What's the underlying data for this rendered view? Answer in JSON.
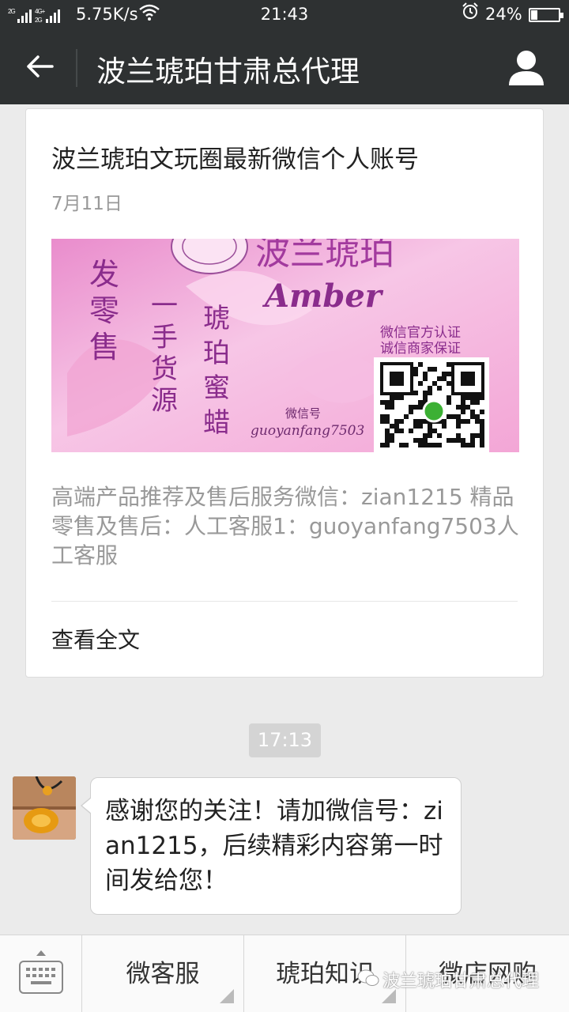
{
  "status_bar": {
    "signal": "2G 4G⁺ 2G",
    "net_speed": "5.75K/s",
    "time": "21:43",
    "battery_pct": "24%",
    "battery_level": 0.24
  },
  "nav": {
    "title": "波兰琥珀甘肃总代理"
  },
  "article": {
    "title": "波兰琥珀文玩圈最新微信个人账号",
    "date": "7月11日",
    "banner": {
      "top_text": "波兰琥珀",
      "word": "Amber",
      "left_col": "批发零售",
      "mid_col": "一手货源",
      "right_col": "琥珀蜜蜡",
      "cert1": "微信官方认证",
      "cert2": "诚信商家保证",
      "wechat_label": "微信号",
      "wechat_id": "guoyanfang7503"
    },
    "description": "高端产品推荐及售后服务微信：zian1215 精品零售及售后：人工客服1：guoyanfang7503人工客服",
    "read_more": "查看全文"
  },
  "chat": {
    "timestamp": "17:13",
    "message": "感谢您的关注！请加微信号：zian1215，后续精彩内容第一时间发给您！"
  },
  "menu": {
    "items": [
      {
        "label": "微客服"
      },
      {
        "label": "琥珀知识"
      },
      {
        "label": "微店网购"
      }
    ]
  },
  "watermark": "波兰琥珀甘肃总代理",
  "icons": {
    "back": "arrow-left-icon",
    "profile": "person-icon",
    "wifi": "wifi-icon",
    "alarm": "alarm-clock-icon",
    "battery": "battery-icon",
    "keyboard": "keyboard-icon"
  },
  "colors": {
    "header": "#2e3132",
    "background": "#ebebeb",
    "banner_pink": "#f2b6dc",
    "banner_purple": "#8a2c8c"
  }
}
